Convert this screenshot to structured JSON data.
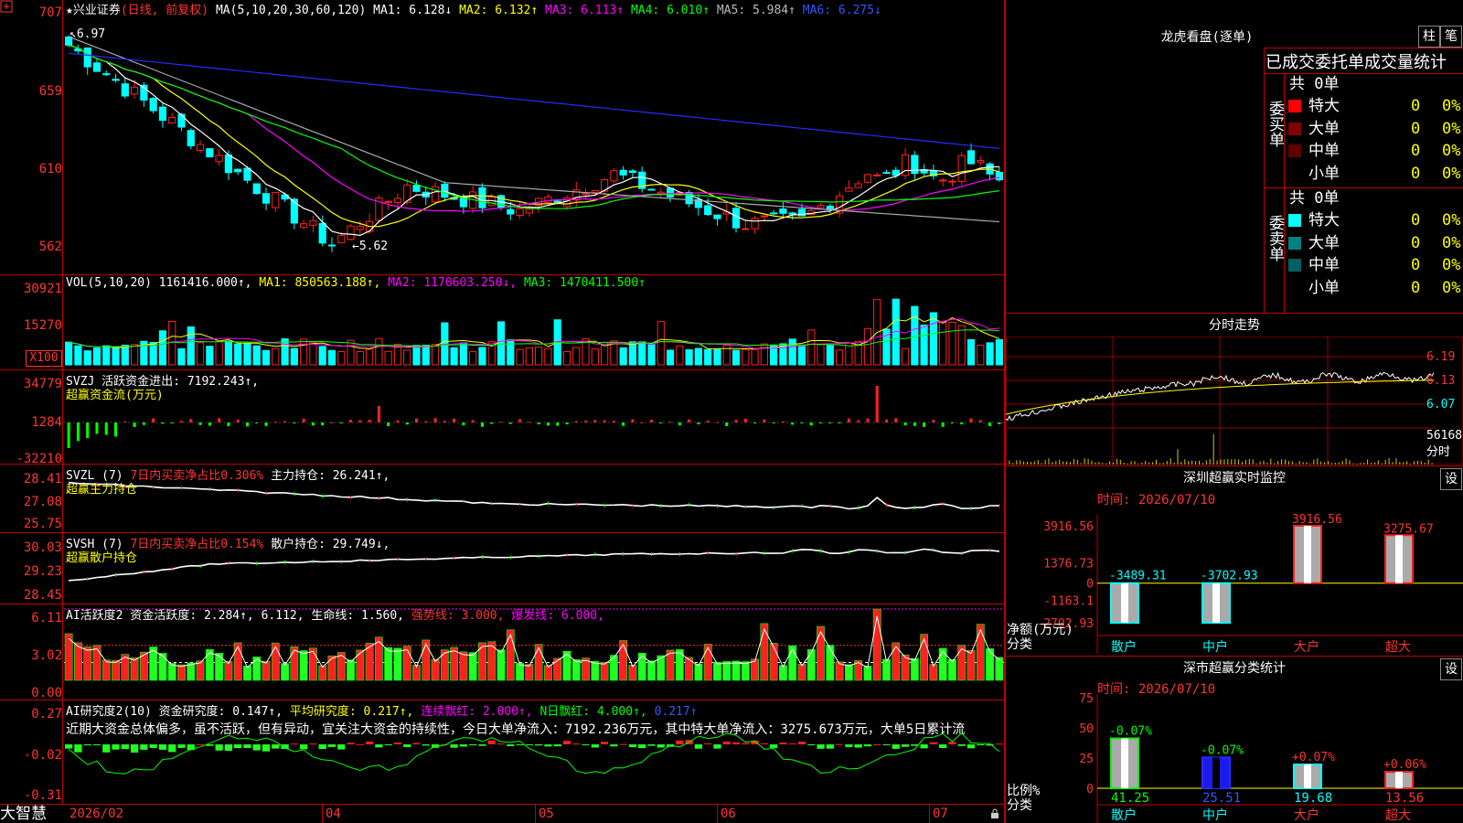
{
  "app": {
    "brand": "大智慧"
  },
  "main": {
    "stock_name": "★兴业证券",
    "mode": "(日线, 前复权)",
    "ma_label": "MA(5,10,20,30,60,120)",
    "ma1": "MA1: 6.128↓",
    "ma2": "MA2: 6.132↑",
    "ma3": "MA3: 6.113↑",
    "ma4": "MA4: 6.010↑",
    "ma5": "MA5: 5.984↑",
    "ma6": "MA6: 6.275↓",
    "y_ticks": [
      "707",
      "659",
      "610",
      "562"
    ],
    "high_label": "6.97",
    "low_label": "←5.62",
    "colors": {
      "ma1": "#ffffff",
      "ma2": "#ffff00",
      "ma3": "#ff00ff",
      "ma4": "#00ff00",
      "ma5": "#aaaaaa",
      "ma6": "#2a2aff",
      "up": "#ff2020",
      "down": "#00ffff"
    }
  },
  "vol": {
    "title": "VOL(5,10,20)",
    "val": "1161416.000↑,",
    "ma1": "MA1: 850563.188↑,",
    "ma2": "MA2: 1170603.250↓,",
    "ma3": "MA3: 1470411.500↑",
    "y_ticks": [
      "30921",
      "15270"
    ],
    "unit": "X100"
  },
  "svzj": {
    "title": "SVZJ",
    "sub1": "活跃资金进出: 7192.243↑,",
    "sub2": "超赢资金流(万元)",
    "y_ticks": [
      "34779",
      "1284",
      "-32210"
    ]
  },
  "svzl": {
    "title": "SVZL (7)",
    "a": "7日内买卖净占比0.306%",
    "b": "主力持仓: 26.241↑,",
    "c": "超赢主力持仓",
    "y_ticks": [
      "28.41",
      "27.08",
      "25.75"
    ]
  },
  "svsh": {
    "title": "SVSH (7)",
    "a": "7日内买卖净占比0.154%",
    "b": "散户持仓: 29.749↓,",
    "c": "超赢散户持仓",
    "y_ticks": [
      "30.03",
      "29.23",
      "28.45"
    ]
  },
  "ai1": {
    "title": "AI活跃度2",
    "a": "资金活跃度: 2.284↑,",
    "b": "6.112,",
    "c": "生命线: 1.560,",
    "d": "强势线: 3.000,",
    "e": "爆发线: 6.000,",
    "y_ticks": [
      "6.11",
      "3.02",
      "0.00"
    ]
  },
  "ai2": {
    "title": "AI研究度2(10)",
    "a": "资金研究度: 0.147↑,",
    "b": "平均研究度: 0.217↑,",
    "c": "连续飘红: 2.000↑,",
    "d": "N日飘红: 4.000↑,",
    "e": "0.217↑",
    "desc": "近期大资金总体偏多，虽不活跃，但有异动，宜关注大资金的持续性，今日大单净流入：7192.236万元，其中特大单净流入：3275.673万元，大单5日累计流",
    "y_ticks": [
      "0.27",
      "-0.02",
      "-0.31"
    ]
  },
  "xaxis": [
    "2026/02",
    "04",
    "05",
    "06",
    "07"
  ],
  "right": {
    "lhb": {
      "title": "龙虎看盘(逐单)",
      "btn1": "柱",
      "btn2": "笔",
      "header": "已成交委托单成交量统计",
      "buy_label": "委买单",
      "sell_label": "委卖单",
      "buy_total": "共 0单",
      "sell_total": "共 0单",
      "buy_rows": [
        {
          "name": "特大",
          "v": "0",
          "p": "0%",
          "color": "#ff0000"
        },
        {
          "name": "大单",
          "v": "0",
          "p": "0%",
          "color": "#800000"
        },
        {
          "name": "中单",
          "v": "0",
          "p": "0%",
          "color": "#600000"
        },
        {
          "name": "小单",
          "v": "0",
          "p": "0%",
          "color": "#000000"
        }
      ],
      "sell_rows": [
        {
          "name": "特大",
          "v": "0",
          "p": "0%",
          "color": "#00ffff"
        },
        {
          "name": "大单",
          "v": "0",
          "p": "0%",
          "color": "#008080"
        },
        {
          "name": "中单",
          "v": "0",
          "p": "0%",
          "color": "#006060"
        },
        {
          "name": "小单",
          "v": "0",
          "p": "0%",
          "color": "#000000"
        }
      ]
    },
    "fenshi": {
      "title": "分时走势",
      "p1": "6.19",
      "p2": "6.13",
      "p3": "6.07",
      "vol": "56168",
      "vol_label": "分时"
    },
    "monitor": {
      "title": "深圳超赢实时监控",
      "btn": "设",
      "time": "时间: 2026/07/10",
      "y_ticks": [
        "3916.56",
        "1376.73",
        "0",
        "-1163.1",
        "-2702.93"
      ],
      "ylabel1": "净额(万元)",
      "ylabel2": "分类",
      "categories": [
        "散户",
        "中户",
        "大户",
        "超大"
      ],
      "labels": [
        "-3489.31",
        "-3702.93",
        "3916.56",
        "3275.67"
      ]
    },
    "classify": {
      "title": "深市超赢分类统计",
      "btn": "设",
      "time": "时间: 2026/07/10",
      "y_ticks": [
        "75",
        "50",
        "25",
        "0"
      ],
      "ylabel1": "比例%",
      "ylabel2": "分类",
      "categories": [
        "散户",
        "中户",
        "大户",
        "超大"
      ],
      "deltas": [
        "-0.07%",
        "-0.07%",
        "+0.07%",
        "+0.06%"
      ],
      "values_text": [
        "41.25",
        "25.51",
        "19.68",
        "13.56"
      ]
    }
  },
  "chart_data": [
    {
      "type": "bar",
      "title": "深圳超赢实时监控",
      "categories": [
        "散户",
        "中户",
        "大户",
        "超大"
      ],
      "values": [
        -3489.31,
        -3702.93,
        3916.56,
        3275.67
      ],
      "ylabel": "净额(万元)",
      "ylim": [
        -2702.93,
        3916.56
      ]
    },
    {
      "type": "bar",
      "title": "深市超赢分类统计",
      "categories": [
        "散户",
        "中户",
        "大户",
        "超大"
      ],
      "values": [
        41.25,
        25.51,
        19.68,
        13.56
      ],
      "ylabel": "比例%",
      "ylim": [
        0,
        75
      ]
    }
  ]
}
